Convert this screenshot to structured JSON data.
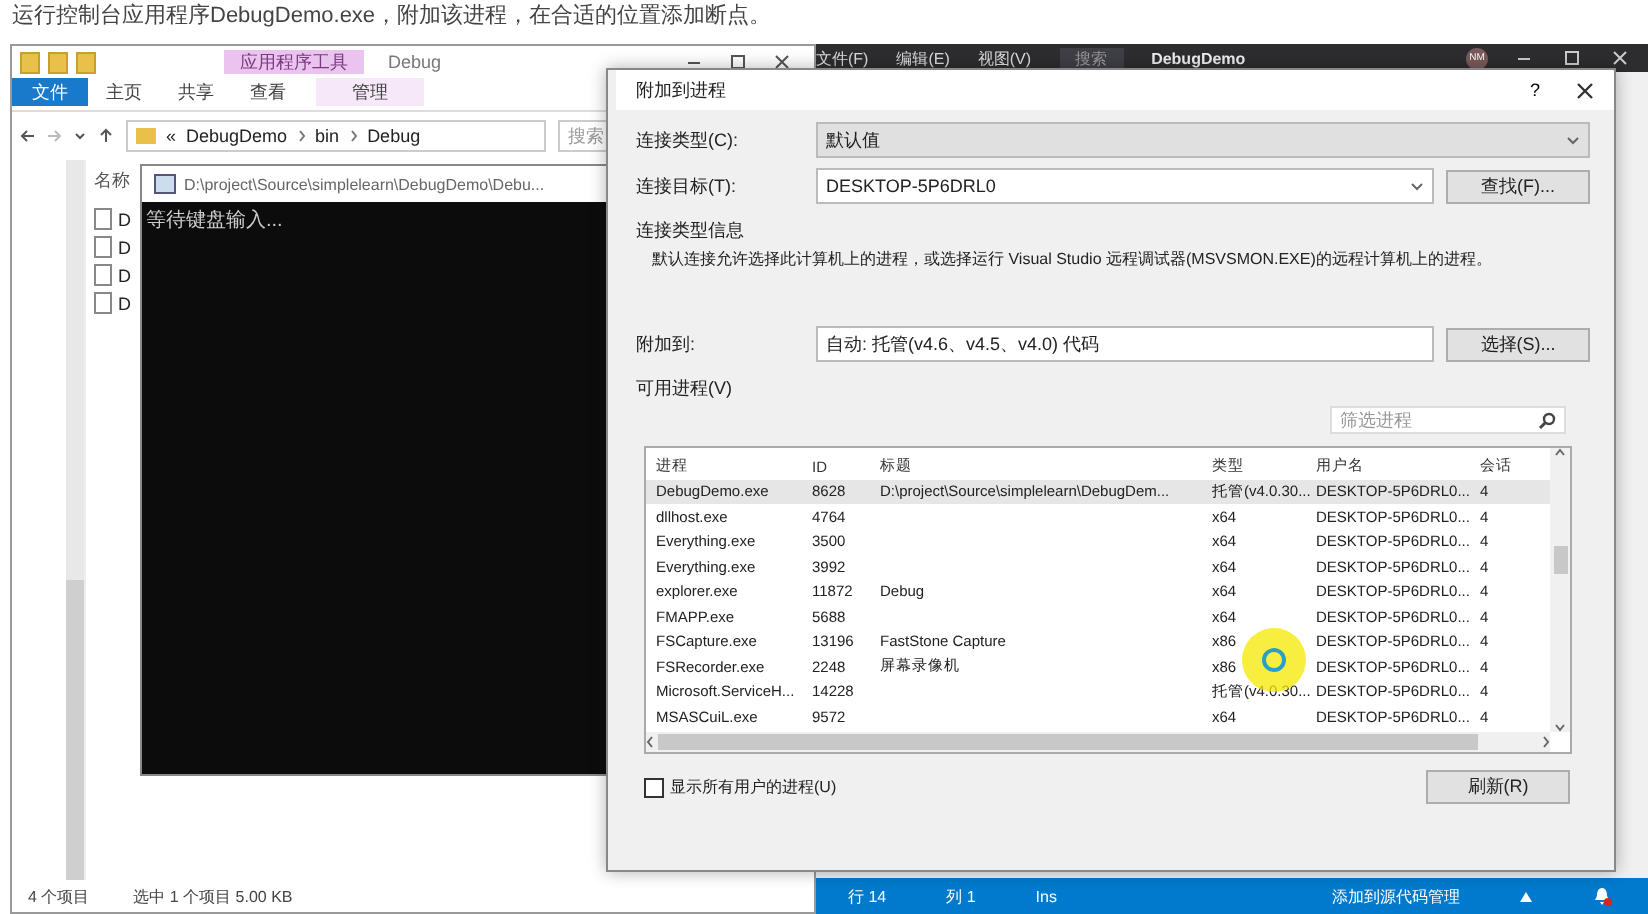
{
  "caption": "运行控制台应用程序DebugDemo.exe，附加该进程，在合适的位置添加断点。",
  "explorer": {
    "context_tab": "应用程序工具",
    "title": "Debug",
    "tabs": [
      {
        "label": "文件",
        "kind": "file"
      },
      {
        "label": "主页",
        "kind": "normal"
      },
      {
        "label": "共享",
        "kind": "normal"
      },
      {
        "label": "查看",
        "kind": "normal"
      },
      {
        "label": "管理",
        "kind": "context"
      }
    ],
    "path_overflow": "«",
    "path": [
      "DebugDemo",
      "bin",
      "Debug"
    ],
    "search_placeholder": "搜索",
    "column": "名称",
    "files": [
      "D",
      "D",
      "D",
      "D"
    ],
    "status": [
      "4 个项目",
      "选中 1 个项目  5.00 KB"
    ]
  },
  "console": {
    "title": "D:\\project\\Source\\simplelearn\\DebugDemo\\Debu...",
    "text": "等待键盘输入..."
  },
  "vs": {
    "menu": [
      "文件(F)",
      "编辑(E)",
      "视图(V)"
    ],
    "search_placeholder": "搜索",
    "title": "DebugDemo",
    "avatar": "NM",
    "status": [
      "行 14",
      "列 1",
      "Ins"
    ],
    "source_control": "添加到源代码管理"
  },
  "dialog": {
    "title": "附加到进程",
    "help": "?",
    "connection_type": {
      "label": "连接类型(C):",
      "value": "默认值"
    },
    "connection_target": {
      "label": "连接目标(T):",
      "value": "DESKTOP-5P6DRL0",
      "button": "查找(F)..."
    },
    "info_title": "连接类型信息",
    "info_text": "默认连接允许选择此计算机上的进程，或选择运行 Visual Studio 远程调试器(MSVSMON.EXE)的远程计算机上的进程。",
    "attach_to": {
      "label": "附加到:",
      "value": "自动: 托管(v4.6、v4.5、v4.0) 代码",
      "button": "选择(S)..."
    },
    "available_label": "可用进程(V)",
    "filter_placeholder": "筛选进程",
    "columns": [
      "进程",
      "ID",
      "标题",
      "类型",
      "用户名",
      "会话"
    ],
    "rows": [
      {
        "cells": [
          "DebugDemo.exe",
          "8628",
          "D:\\project\\Source\\simplelearn\\DebugDem...",
          "托管(v4.0.30...",
          "DESKTOP-5P6DRL0...",
          "4"
        ],
        "selected": true
      },
      {
        "cells": [
          "dllhost.exe",
          "4764",
          "",
          "x64",
          "DESKTOP-5P6DRL0...",
          "4"
        ],
        "selected": false
      },
      {
        "cells": [
          "Everything.exe",
          "3500",
          "",
          "x64",
          "DESKTOP-5P6DRL0...",
          "4"
        ],
        "selected": false
      },
      {
        "cells": [
          "Everything.exe",
          "3992",
          "",
          "x64",
          "DESKTOP-5P6DRL0...",
          "4"
        ],
        "selected": false
      },
      {
        "cells": [
          "explorer.exe",
          "11872",
          "Debug",
          "x64",
          "DESKTOP-5P6DRL0...",
          "4"
        ],
        "selected": false
      },
      {
        "cells": [
          "FMAPP.exe",
          "5688",
          "",
          "x64",
          "DESKTOP-5P6DRL0...",
          "4"
        ],
        "selected": false
      },
      {
        "cells": [
          "FSCapture.exe",
          "13196",
          "FastStone Capture",
          "x86",
          "DESKTOP-5P6DRL0...",
          "4"
        ],
        "selected": false
      },
      {
        "cells": [
          "FSRecorder.exe",
          "2248",
          "屏幕录像机",
          "x86",
          "DESKTOP-5P6DRL0...",
          "4"
        ],
        "selected": false
      },
      {
        "cells": [
          "Microsoft.ServiceH...",
          "14228",
          "",
          "托管(v4.0.30...",
          "DESKTOP-5P6DRL0...",
          "4"
        ],
        "selected": false
      },
      {
        "cells": [
          "MSASCuiL.exe",
          "9572",
          "",
          "x64",
          "DESKTOP-5P6DRL0...",
          "4"
        ],
        "selected": false
      }
    ],
    "show_all": {
      "label": "显示所有用户的进程(U)",
      "checked": false
    },
    "refresh": "刷新(R)"
  }
}
